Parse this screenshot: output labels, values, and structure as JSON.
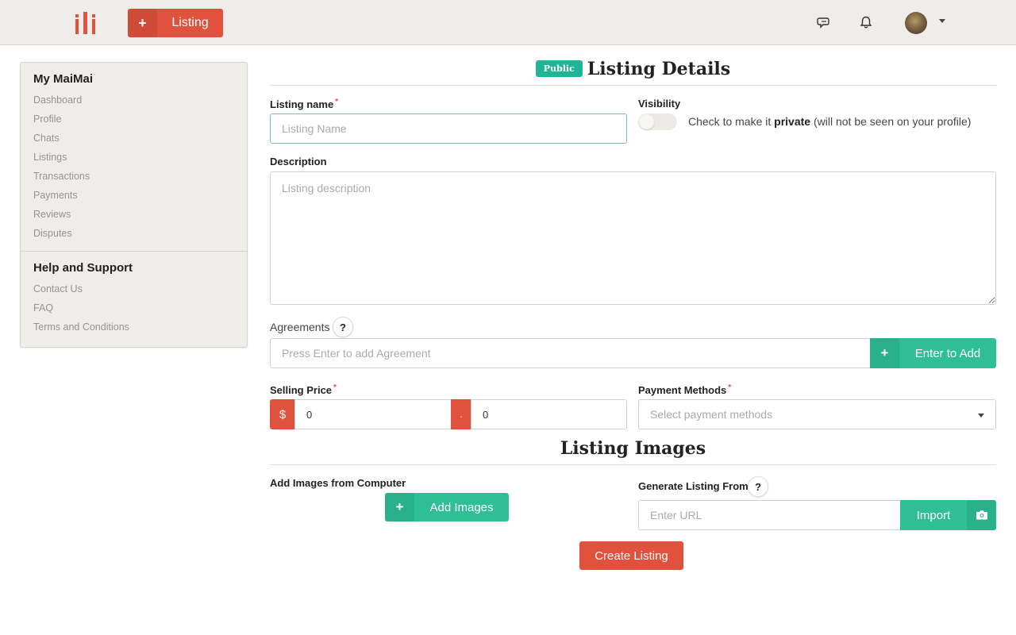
{
  "header": {
    "new_listing_label": "Listing"
  },
  "sidebar": {
    "sections": [
      {
        "title": "My MaiMai",
        "items": [
          "Dashboard",
          "Profile",
          "Chats",
          "Listings",
          "Transactions",
          "Payments",
          "Reviews",
          "Disputes"
        ]
      },
      {
        "title": "Help and Support",
        "items": [
          "Contact Us",
          "FAQ",
          "Terms and Conditions"
        ]
      }
    ]
  },
  "details": {
    "badge": "Public",
    "title": "Listing Details",
    "listing_name_label": "Listing name",
    "listing_name_placeholder": "Listing Name",
    "visibility_label": "Visibility",
    "visibility_text_before": "Check to make it ",
    "visibility_text_bold": "private",
    "visibility_text_after": " (will not be seen on your profile)",
    "visibility_checked": false,
    "description_label": "Description",
    "description_placeholder": "Listing description",
    "agreements_label": "Agreements",
    "agreements_help": "?",
    "agreements_placeholder": "Press Enter to add Agreement",
    "enter_to_add_label": "Enter to Add",
    "selling_price_label": "Selling Price",
    "currency_symbol": "$",
    "decimal_symbol": ".",
    "price_whole": "0",
    "price_cents": "0",
    "payment_methods_label": "Payment Methods",
    "payment_methods_placeholder": "Select payment methods"
  },
  "images": {
    "title": "Listing Images",
    "add_from_computer_label": "Add Images from Computer",
    "add_images_button": "Add Images",
    "generate_from_label": "Generate Listing From",
    "generate_help": "?",
    "url_placeholder": "Enter URL",
    "import_button": "Import"
  },
  "actions": {
    "create_listing": "Create Listing"
  },
  "colors": {
    "accent_red": "#e0523d",
    "accent_teal": "#2ebf97",
    "badge_teal": "#20b594",
    "topbar_bg": "#eeede9"
  }
}
